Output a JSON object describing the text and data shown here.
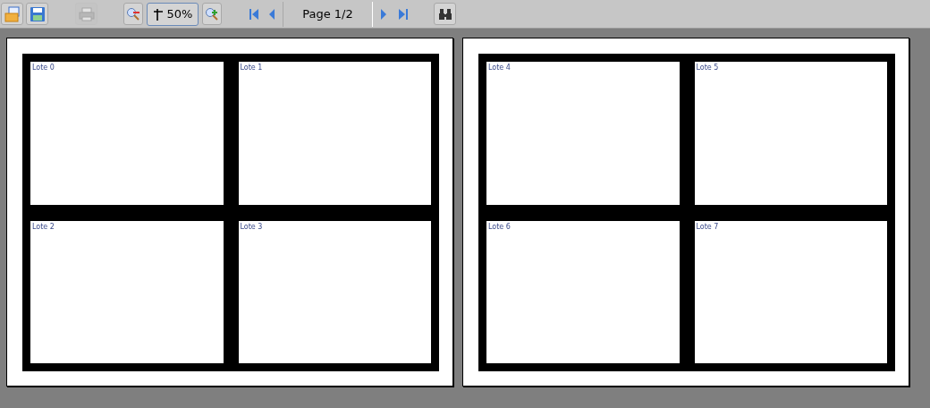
{
  "toolbar": {
    "print_disabled": true,
    "zoom": "50%",
    "page": "Page 1/2"
  },
  "pages": [
    {
      "labels": [
        "Lote 0",
        "Lote 1",
        "Lote 2",
        "Lote 3"
      ]
    },
    {
      "labels": [
        "Lote 4",
        "Lote 5",
        "Lote 6",
        "Lote 7"
      ]
    }
  ]
}
